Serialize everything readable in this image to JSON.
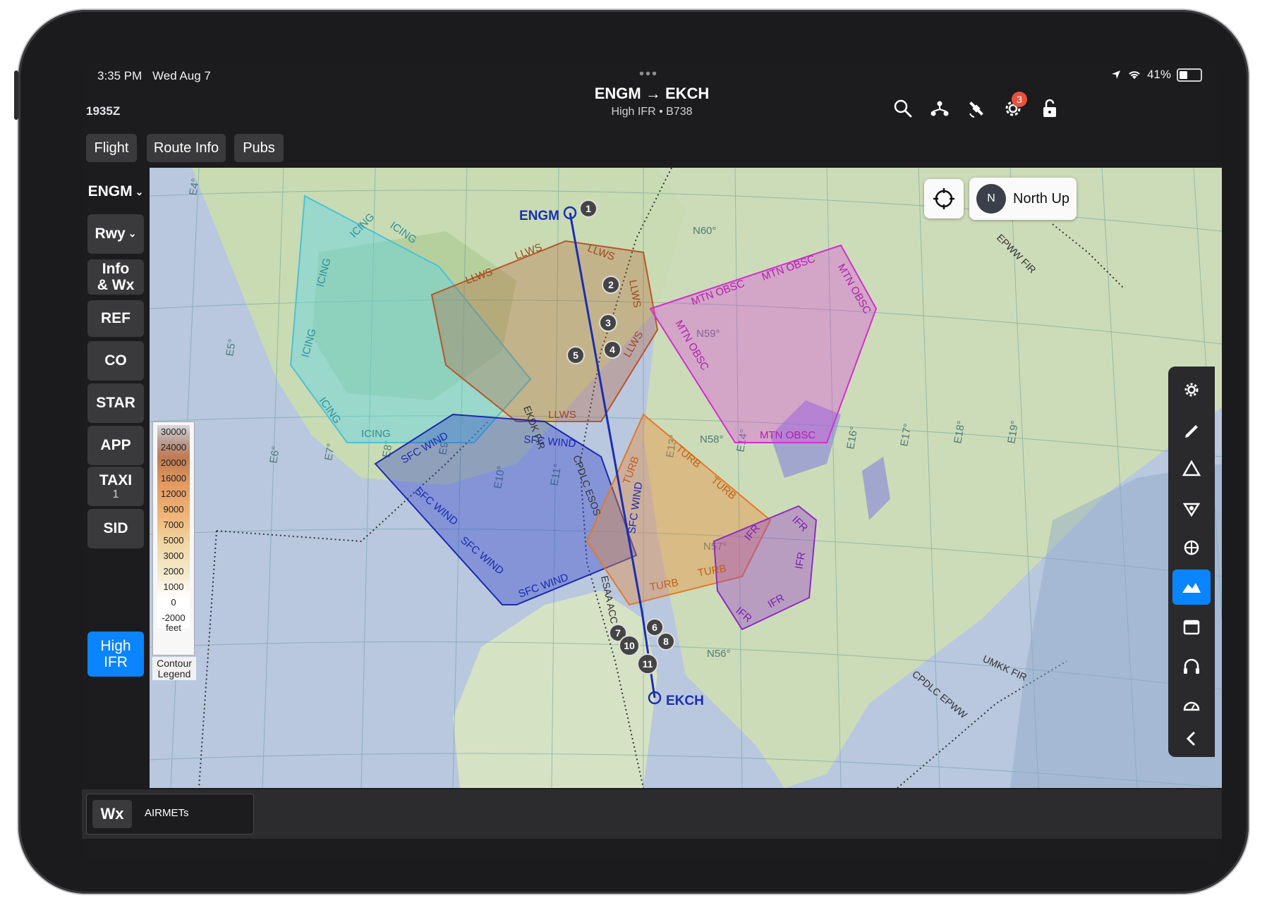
{
  "status_bar": {
    "time": "3:35 PM",
    "date": "Wed Aug 7",
    "battery": "41%"
  },
  "header": {
    "zulu": "1935Z",
    "route": "ENGM → EKCH",
    "subtitle": "High IFR • B738",
    "settings_badge": "3",
    "icons": [
      "search-icon",
      "route-icon",
      "satellite-icon",
      "gear-icon",
      "lock-icon"
    ]
  },
  "tabs": [
    "Flight",
    "Route Info",
    "Pubs"
  ],
  "left_panel": {
    "airport": "ENGM",
    "rwy": "Rwy",
    "info_wx": [
      "Info",
      "& Wx"
    ],
    "ref": "REF",
    "co": "CO",
    "star": "STAR",
    "app": "APP",
    "taxi": "TAXI",
    "taxi_count": "1",
    "sid": "SID",
    "high_ifr": [
      "High",
      "IFR"
    ]
  },
  "map": {
    "north_up": "North Up",
    "compass_letter": "N",
    "airports": {
      "origin": "ENGM",
      "destination": "EKCH"
    },
    "waypoints": [
      "1",
      "2",
      "3",
      "4",
      "5",
      "6",
      "7",
      "8",
      "10",
      "11"
    ],
    "lat_labels": [
      "N60°",
      "N59°",
      "N58°",
      "N57°",
      "N56°"
    ],
    "lon_labels": [
      "E4°",
      "E5°",
      "E6°",
      "E7°",
      "E8°",
      "E9°",
      "E10°",
      "E11°",
      "E13°",
      "E14°",
      "E16°",
      "E17°",
      "E18°",
      "E19°"
    ],
    "airmet_labels": {
      "icing": "ICING",
      "llws": "LLWS",
      "mtn_obsc": "MTN OBSC",
      "sfc_wind": "SFC WIND",
      "turb": "TURB",
      "ifr": "IFR"
    },
    "airspace_labels": [
      "ESAA ACC",
      "CPDLC ESOS",
      "EKDK FIR",
      "CPDLC EPWW",
      "UMKK FIR",
      "EPWW FIR"
    ],
    "contour_legend": {
      "levels": [
        "30000",
        "24000",
        "20000",
        "16000",
        "12000",
        "9000",
        "7000",
        "5000",
        "3000",
        "2000",
        "1000",
        "0",
        "-2000"
      ],
      "unit": "feet",
      "caption": [
        "Contour",
        "Legend"
      ]
    },
    "colors": {
      "icing": "#5fd4e6",
      "llws": "#b5562a",
      "mtn_obsc": "#e040e0",
      "sfc_wind": "#2336c8",
      "turb": "#e8893a",
      "ifr": "#9b3fd0",
      "route": "#1a2fb0"
    }
  },
  "right_toolbar": [
    "gear-icon",
    "pen-icon",
    "triangle-icon",
    "layers-icon",
    "globe-icon",
    "terrain-icon",
    "calendar-icon",
    "headphones-icon",
    "gauge-icon",
    "chevron-left-icon"
  ],
  "bottom_bar": {
    "wx_button": "Wx",
    "layer": "AIRMETs"
  }
}
